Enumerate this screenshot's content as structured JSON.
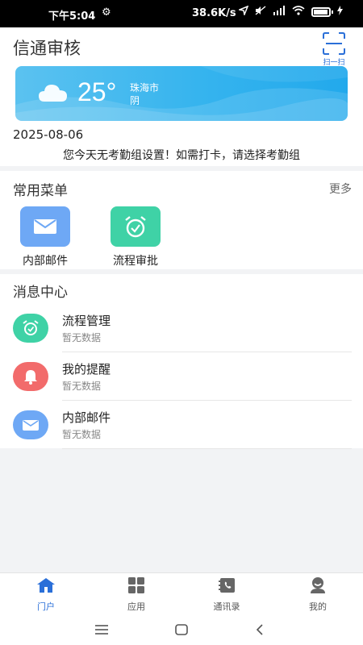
{
  "status_bar": {
    "time": "下午5:04",
    "network_speed": "38.6K/s",
    "battery_icon": "battery-icon"
  },
  "header": {
    "title": "信通审核",
    "scan_label": "扫一扫"
  },
  "weather": {
    "temperature": "25°",
    "city": "珠海市",
    "condition": "阴"
  },
  "date": "2025-08-06",
  "notice": "您今天无考勤组设置！如需打卡，请选择考勤组",
  "menu": {
    "title": "常用菜单",
    "more": "更多",
    "items": [
      {
        "label": "内部邮件",
        "icon": "mail-icon",
        "color": "#6ea8f5"
      },
      {
        "label": "流程审批",
        "icon": "alarm-clock-icon",
        "color": "#3fd2a6"
      }
    ]
  },
  "messages": {
    "title": "消息中心",
    "items": [
      {
        "title": "流程管理",
        "subtitle": "暂无数据",
        "icon": "alarm-clock-icon",
        "color": "#3fd2a6"
      },
      {
        "title": "我的提醒",
        "subtitle": "暂无数据",
        "icon": "bell-icon",
        "color": "#f26b6b"
      },
      {
        "title": "内部邮件",
        "subtitle": "暂无数据",
        "icon": "mail-icon",
        "color": "#6ea8f5"
      }
    ]
  },
  "tabbar": {
    "active": "门户",
    "items": [
      {
        "label": "门户",
        "icon": "home-icon"
      },
      {
        "label": "应用",
        "icon": "apps-grid-icon"
      },
      {
        "label": "通讯录",
        "icon": "contacts-book-icon"
      },
      {
        "label": "我的",
        "icon": "user-icon"
      }
    ]
  },
  "colors": {
    "accent": "#2a6fd8",
    "weather_gradient_start": "#5bc2f0",
    "weather_gradient_end": "#22a9ec"
  }
}
